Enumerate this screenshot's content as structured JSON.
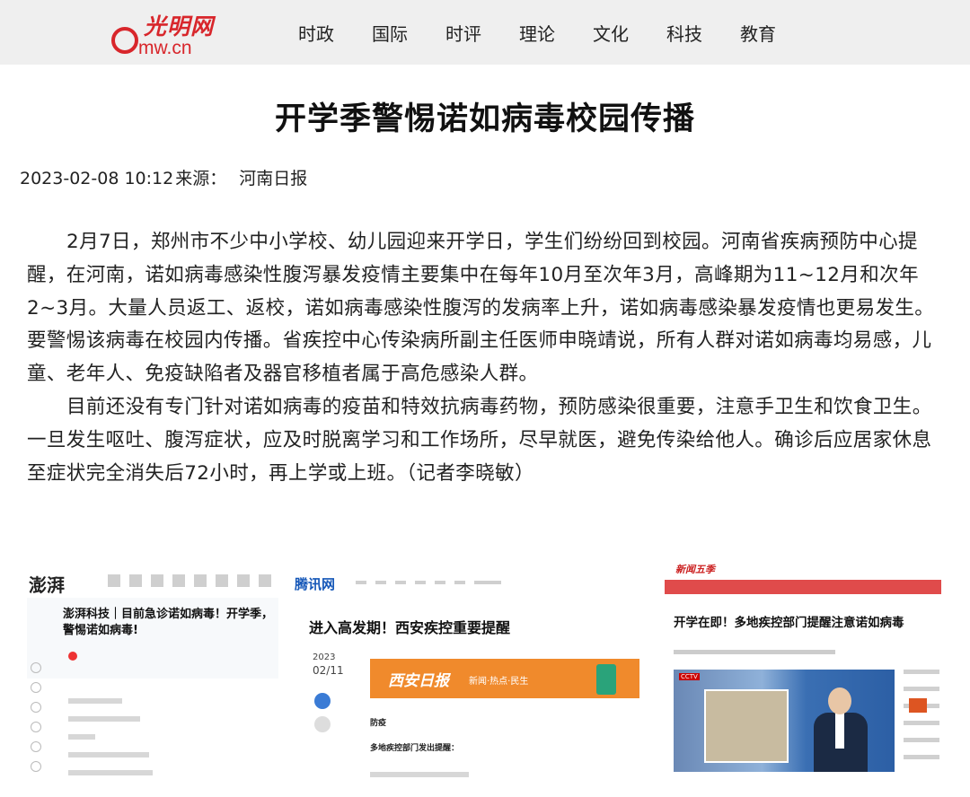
{
  "site": {
    "logo_calligraphy": "光明网",
    "logo_url": "mw.cn"
  },
  "nav": {
    "items": [
      "时政",
      "国际",
      "时评",
      "理论",
      "文化",
      "科技",
      "教育"
    ]
  },
  "article": {
    "title": "开学季警惕诺如病毒校园传播",
    "datetime": "2023-02-08 10:12",
    "source_label": "来源：",
    "source": "河南日报",
    "paragraphs": [
      "2月7日，郑州市不少中小学校、幼儿园迎来开学日，学生们纷纷回到校园。河南省疾病预防中心提醒，在河南，诺如病毒感染性腹泻暴发疫情主要集中在每年10月至次年3月，高峰期为11~12月和次年2~3月。大量人员返工、返校，诺如病毒感染性腹泻的发病率上升，诺如病毒感染暴发疫情也更易发生。要警惕该病毒在校园内传播。省疾控中心传染病所副主任医师申晓靖说，所有人群对诺如病毒均易感，儿童、老年人、免疫缺陷者及器官移植者属于高危感染人群。",
      "目前还没有专门针对诺如病毒的疫苗和特效抗病毒药物，预防感染很重要，注意手卫生和饮食卫生。一旦发生呕吐、腹泻症状，应及时脱离学习和工作场所，尽早就医，避免传染给他人。确诊后应居家休息至症状完全消失后72小时，再上学或上班。（记者李晓敏）"
    ]
  },
  "thumbnails": [
    {
      "site_logo": "澎湃",
      "title": "澎湃科技｜目前急诊诺如病毒！开学季，警惕诺如病毒!"
    },
    {
      "site_logo": "腾讯网",
      "title": "进入高发期！西安疾控重要提醒",
      "date_day": "2023",
      "date_md": "02/11",
      "banner_text": "西安日报",
      "banner_sub": "新闻·热点·民生",
      "para1": "防疫",
      "para2": "多地疾控部门发出提醒："
    },
    {
      "site_logo": "新闻五季",
      "title": "开学在即！多地疾控部门提醒注意诺如病毒",
      "cctv": "CCTV"
    }
  ]
}
